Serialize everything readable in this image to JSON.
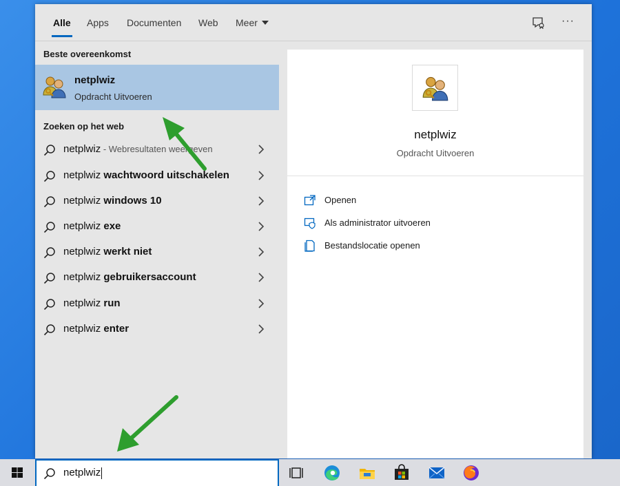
{
  "tabs": [
    {
      "label": "Alle",
      "active": true
    },
    {
      "label": "Apps"
    },
    {
      "label": "Documenten"
    },
    {
      "label": "Web"
    },
    {
      "label": "Meer"
    }
  ],
  "toolbar_icons": [
    "feedback-icon",
    "more-options-icon"
  ],
  "more_label": "···",
  "best_match": {
    "header": "Beste overeenkomst",
    "title": "netplwiz",
    "subtitle": "Opdracht Uitvoeren",
    "icon": "user-accounts-icon"
  },
  "web_search": {
    "header": "Zoeken op het web",
    "items": [
      {
        "prefix": "netplwiz",
        "bold": "",
        "hint": " - Webresultaten weergeven"
      },
      {
        "prefix": "netplwiz ",
        "bold": "wachtwoord uitschakelen",
        "hint": ""
      },
      {
        "prefix": "netplwiz ",
        "bold": "windows 10",
        "hint": ""
      },
      {
        "prefix": "netplwiz ",
        "bold": "exe",
        "hint": ""
      },
      {
        "prefix": "netplwiz ",
        "bold": "werkt niet",
        "hint": ""
      },
      {
        "prefix": "netplwiz ",
        "bold": "gebruikersaccount",
        "hint": ""
      },
      {
        "prefix": "netplwiz ",
        "bold": "run",
        "hint": ""
      },
      {
        "prefix": "netplwiz ",
        "bold": "enter",
        "hint": ""
      }
    ]
  },
  "preview": {
    "title": "netplwiz",
    "subtitle": "Opdracht Uitvoeren",
    "actions": [
      {
        "label": "Openen",
        "icon": "open-icon"
      },
      {
        "label": "Als administrator uitvoeren",
        "icon": "run-as-admin-icon"
      },
      {
        "label": "Bestandslocatie openen",
        "icon": "file-location-icon"
      }
    ]
  },
  "search": {
    "value": "netplwiz"
  },
  "taskbar": {
    "icons": [
      "windows-start-icon",
      "task-view-icon",
      "edge-icon",
      "file-explorer-icon",
      "store-icon",
      "mail-icon",
      "firefox-icon"
    ]
  },
  "colors": {
    "accent": "#0067c0",
    "selected_row": "#a9c6e3",
    "annotation_arrow": "#2e9e2e"
  }
}
